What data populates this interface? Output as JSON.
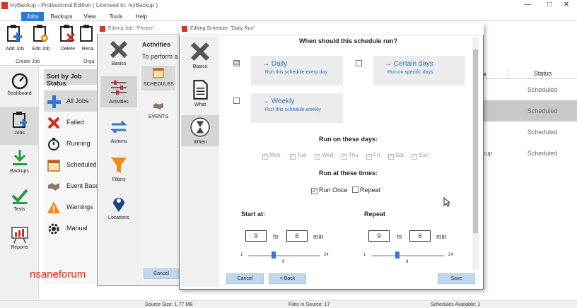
{
  "window": {
    "title": "IvyBackup - Professional Edition ( Licensed to: IvyBackup )",
    "controls": [
      "—",
      "□",
      "✕"
    ]
  },
  "menu": {
    "tabs": [
      "Jobs",
      "Backups",
      "View",
      "Tools",
      "Help"
    ]
  },
  "ribbon": {
    "add_job": "Add Job",
    "edit_job": "Edit Job",
    "delete": "Delete",
    "rename": "Rena",
    "group_label": "Create Job",
    "group2_label": "Orga"
  },
  "nav": {
    "items": [
      "Dashboard",
      "Jobs",
      "Backups",
      "Tests",
      "Reports"
    ]
  },
  "joblist": {
    "header": "Sort by Job Status",
    "items": [
      "All Jobs",
      "Failed",
      "Running",
      "Scheduled",
      "Event Base",
      "Warnings",
      "Manual"
    ]
  },
  "table": {
    "col_name_partial": "e",
    "col_status": "Status",
    "rows": [
      "Scheduled",
      "Scheduled",
      "Scheduled",
      "Scheduled"
    ],
    "partial_row_text": "kup"
  },
  "dialog1": {
    "title": "Editing Job: \"Photos\"",
    "heading": "Activities",
    "subtext": "To perform a",
    "sidebar": [
      "Basics",
      "Activities",
      "Actions",
      "Filters",
      "Locations"
    ],
    "tabs": [
      "SCHEDULES",
      "EVENTS"
    ],
    "cancel": "Cancel"
  },
  "dialog2": {
    "title": "Editing Schedule: \"Daily Run\"",
    "sidebar": [
      "Basics",
      "What",
      "When"
    ],
    "question": "When should this schedule run?",
    "options": [
      {
        "title": "Daily",
        "sub": "Run this schedule every day",
        "checked": "☑"
      },
      {
        "title": "Certain days",
        "sub": "Run on specific days",
        "checked": ""
      },
      {
        "title": "Weekly",
        "sub": "Run this schedule weekly",
        "checked": ""
      }
    ],
    "days_heading": "Run on these days:",
    "days": [
      "Mon",
      "Tue",
      "Wed",
      "Thu",
      "Fri",
      "Sat",
      "Sun"
    ],
    "times_heading": "Run at these times:",
    "run_once": "Run Once",
    "repeat_opt": "Repeat",
    "start_label": "Start at:",
    "repeat_label": "Repeat",
    "start_hr": "9",
    "start_min": "6",
    "repeat_hr": "9",
    "repeat_min": "6",
    "hr_unit": "hr",
    "min_unit": "min",
    "slider_min": "1",
    "slider_max": "24",
    "slider_value": "9",
    "slider_level": 0.35,
    "buttons": {
      "cancel": "Cancel",
      "back": "< Back",
      "save": "Save"
    }
  },
  "statusbar": {
    "source_size": "Source Size: 1.77 MB",
    "files": "Files In Source: 17",
    "schedules": "Schedules Available: 1"
  },
  "watermark": "nsaneforum",
  "colors": {
    "accent": "#2c7ad6",
    "option_bg": "#ececec",
    "link": "#2d6fb8",
    "watermark": "#e8220a"
  }
}
